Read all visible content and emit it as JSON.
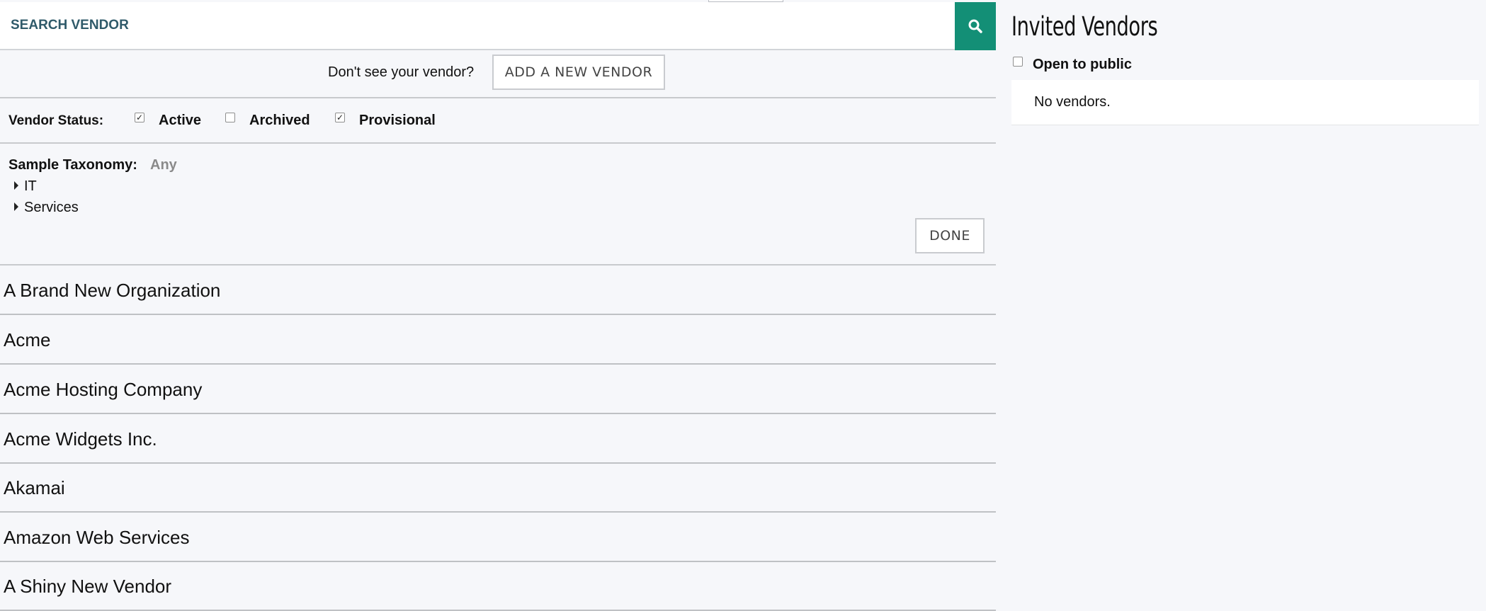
{
  "search": {
    "placeholder": "SEARCH VENDOR"
  },
  "add_vendor": {
    "prompt": "Don't see your vendor?",
    "button_label": "ADD A NEW VENDOR"
  },
  "vendor_status": {
    "label": "Vendor Status:",
    "options": [
      {
        "label": "Active",
        "checked": true
      },
      {
        "label": "Archived",
        "checked": false
      },
      {
        "label": "Provisional",
        "checked": true
      }
    ]
  },
  "taxonomy": {
    "label": "Sample Taxonomy:",
    "value": "Any",
    "items": [
      {
        "label": "IT"
      },
      {
        "label": "Services"
      }
    ],
    "done_label": "DONE"
  },
  "vendors": [
    "A Brand New Organization",
    "Acme",
    "Acme Hosting Company",
    "Acme Widgets Inc.",
    "Akamai",
    "Amazon Web Services",
    "A Shiny New Vendor"
  ],
  "invited": {
    "title": "Invited Vendors",
    "open_to_public_label": "Open to public",
    "open_to_public_checked": false,
    "empty_message": "No vendors."
  },
  "colors": {
    "accent": "#138f76",
    "search_text": "#2f5a6a"
  },
  "icons": {
    "search": "search-icon",
    "expand": "caret-right-icon"
  }
}
